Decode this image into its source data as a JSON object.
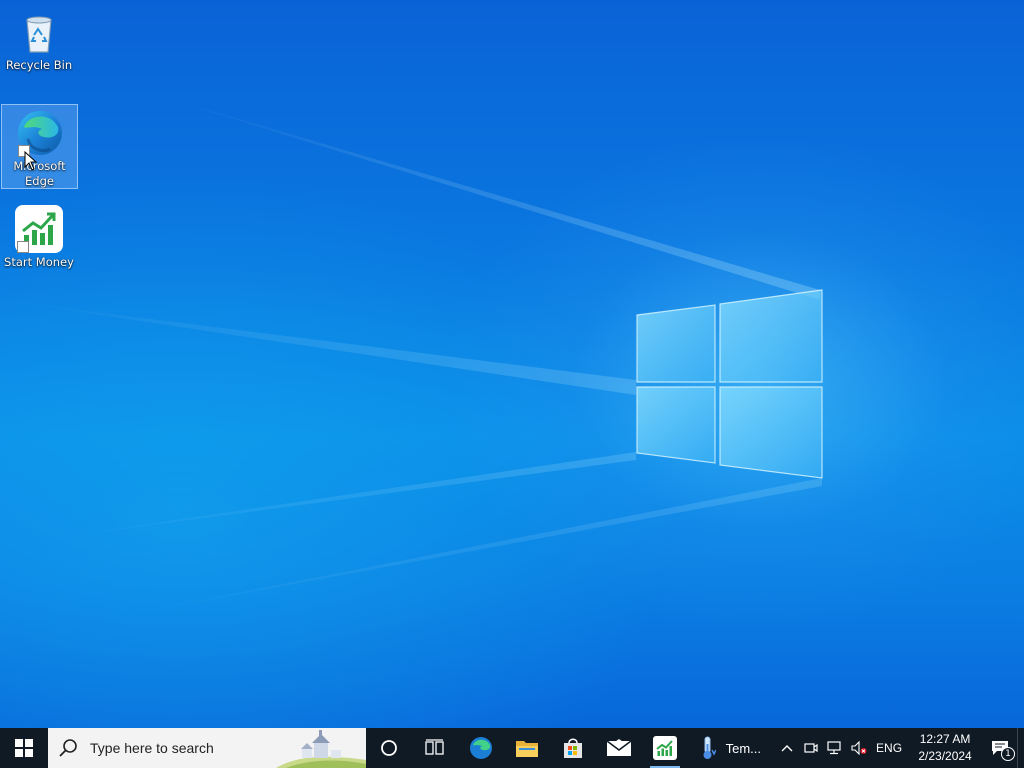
{
  "desktop": {
    "icons": [
      {
        "label": "Recycle Bin",
        "icon": "recycle-bin-icon"
      },
      {
        "label": "Microsoft Edge",
        "icon": "edge-icon",
        "selected": true
      },
      {
        "label": "Start Money",
        "icon": "start-money-icon"
      }
    ]
  },
  "taskbar": {
    "search_placeholder": "Type here to search",
    "pinned": [
      {
        "name": "cortana",
        "icon": "cortana-icon"
      },
      {
        "name": "task-view",
        "icon": "task-view-icon"
      },
      {
        "name": "microsoft-edge",
        "icon": "edge-icon"
      },
      {
        "name": "file-explorer",
        "icon": "folder-icon"
      },
      {
        "name": "microsoft-store",
        "icon": "store-icon"
      },
      {
        "name": "mail",
        "icon": "mail-icon"
      },
      {
        "name": "start-money",
        "icon": "start-money-icon",
        "active": true
      }
    ],
    "weather_label": "Tem..."
  },
  "tray": {
    "language": "ENG",
    "time": "12:27 AM",
    "date": "2/23/2024",
    "notification_count": "1"
  },
  "colors": {
    "taskbar_bg": "#101a24",
    "desktop_blue": "#0a78e0"
  }
}
